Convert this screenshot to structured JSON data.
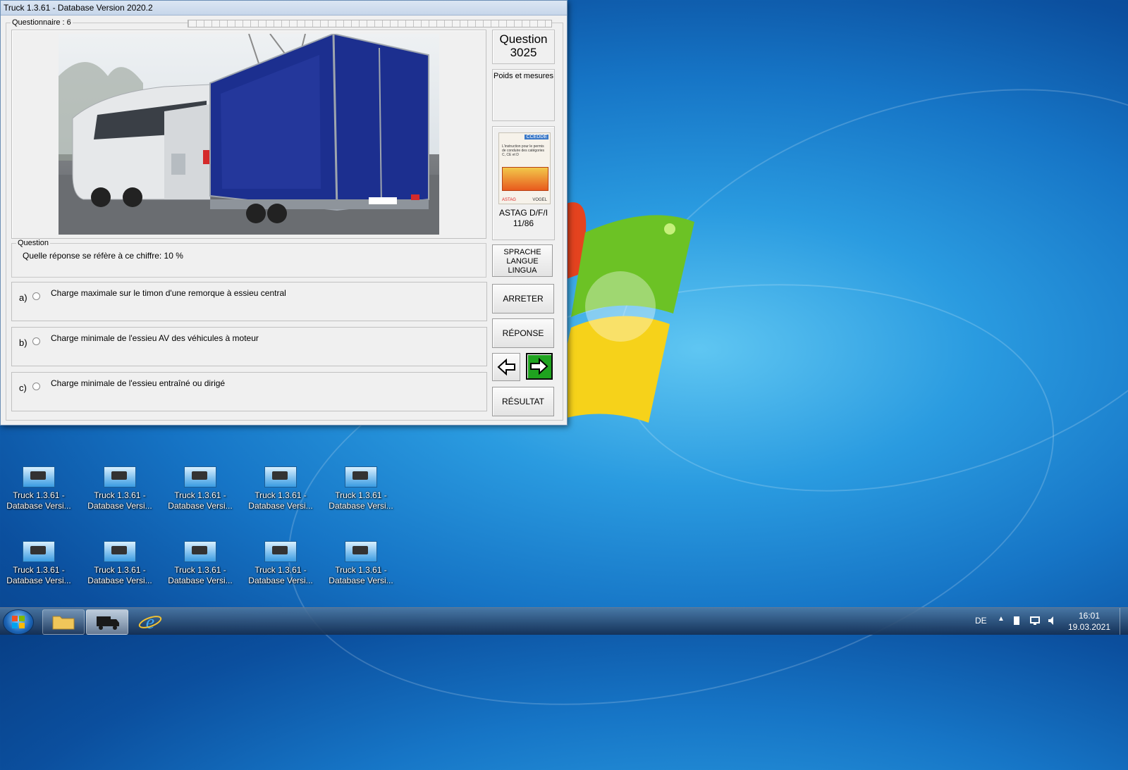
{
  "window": {
    "title": "Truck 1.3.61 - Database Version 2020.2",
    "questionnaire_label": "Questionnaire : 6"
  },
  "question": {
    "header_word": "Question",
    "number": "3025",
    "category": "Poids et mesures",
    "group_label": "Question",
    "text": "Quelle réponse se réfère à ce chiffre:  10 %"
  },
  "book": {
    "cover_badge": "CCEDDE",
    "cover_text": "L'instruction pour le permis de conduire des catégories C, CE et D",
    "cover_brand_left": "ASTAG",
    "cover_brand_right": "VOGEL",
    "ref_line1": "ASTAG D/F/I",
    "ref_line2": "11/86"
  },
  "answers": [
    {
      "letter": "a)",
      "text": "Charge maximale sur le timon d'une remorque à essieu central"
    },
    {
      "letter": "b)",
      "text": "Charge minimale de l'essieu AV des véhicules à moteur"
    },
    {
      "letter": "c)",
      "text": "Charge minimale de l'essieu entraîné ou dirigé"
    }
  ],
  "buttons": {
    "language_line1": "SPRACHE",
    "language_line2": "LANGUE",
    "language_line3": "LINGUA",
    "stop": "ARRETER",
    "answer": "RÉPONSE",
    "result": "RÉSULTAT",
    "prev_icon": "arrow-left-icon",
    "next_icon": "arrow-right-icon"
  },
  "desktop_icons": [
    {
      "line1": "",
      "line2": "Database Versi..."
    },
    {
      "line1": "",
      "line2": "Database Versi..."
    },
    {
      "line1": "",
      "line2": "Database Versi..."
    },
    {
      "line1": "",
      "line2": "Database Versi..."
    },
    {
      "line1": "",
      "line2": "Database Versi..."
    },
    {
      "line1": "Truck 1.3.61 -",
      "line2": "Database Versi..."
    },
    {
      "line1": "Truck 1.3.61 -",
      "line2": "Database Versi..."
    },
    {
      "line1": "Truck 1.3.61 -",
      "line2": "Database Versi..."
    },
    {
      "line1": "Truck 1.3.61 -",
      "line2": "Database Versi..."
    },
    {
      "line1": "Truck 1.3.61 -",
      "line2": "Database Versi..."
    },
    {
      "line1": "Truck 1.3.61 -",
      "line2": "Database Versi..."
    },
    {
      "line1": "Truck 1.3.61 -",
      "line2": "Database Versi..."
    },
    {
      "line1": "Truck 1.3.61 -",
      "line2": "Database Versi..."
    },
    {
      "line1": "Truck 1.3.61 -",
      "line2": "Database Versi..."
    },
    {
      "line1": "Truck 1.3.61 -",
      "line2": "Database Versi..."
    }
  ],
  "taskbar": {
    "language": "DE",
    "time": "16:01",
    "date": "19.03.2021"
  },
  "colors": {
    "next_button": "#1fa31f",
    "trailer_blue": "#1c2f8f"
  }
}
